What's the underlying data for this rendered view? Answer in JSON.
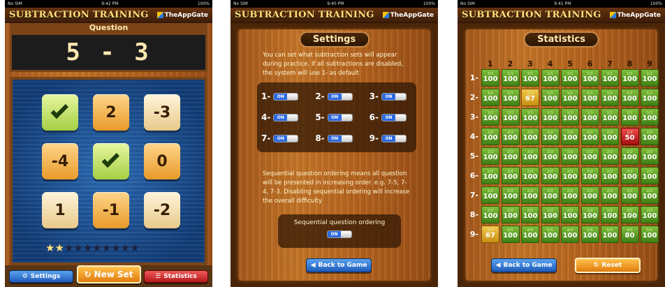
{
  "app": {
    "title": "SUBTRACTION TRAINING",
    "brand": "TheAppGate"
  },
  "screens": [
    {
      "status": {
        "left": "No SIM",
        "time": "9:42 PM",
        "battery": "100%"
      }
    },
    {
      "status": {
        "left": "No SIM",
        "time": "9:40 PM",
        "battery": "100%"
      }
    },
    {
      "status": {
        "left": "No SIM",
        "time": "9:41 PM",
        "battery": "100%"
      }
    }
  ],
  "game": {
    "question_label": "Question",
    "question": "5 - 3",
    "tiles": [
      "check",
      "2",
      "-3",
      "-4",
      "check",
      "0",
      "1",
      "-1",
      "-2"
    ],
    "stars_filled": 2,
    "stars_total": 10,
    "buttons": {
      "settings": "Settings",
      "new_set": "New Set",
      "statistics": "Statistics"
    }
  },
  "settings": {
    "title": "Settings",
    "intro": "You can set what subtraction sets will appear during practice. If all subtractions are disabled, the system will use 1- as default",
    "sets": [
      {
        "label": "1-",
        "state": "ON"
      },
      {
        "label": "2-",
        "state": "ON"
      },
      {
        "label": "3-",
        "state": "ON"
      },
      {
        "label": "4-",
        "state": "ON"
      },
      {
        "label": "5-",
        "state": "ON"
      },
      {
        "label": "6-",
        "state": "ON"
      },
      {
        "label": "7-",
        "state": "ON"
      },
      {
        "label": "8-",
        "state": "ON"
      },
      {
        "label": "9-",
        "state": "ON"
      }
    ],
    "seq_text": "Sequential question ordering means all question will be presented in increasing order. e.g. 7-5, 7-4, 7-3. Disabling sequential ordering will increase the overall difficulty",
    "seq_label": "Sequential question ordering",
    "seq_state": "ON",
    "back_button": "Back to Game"
  },
  "statistics": {
    "title": "Statistics",
    "columns": [
      "1",
      "2",
      "3",
      "4",
      "5",
      "6",
      "7",
      "8",
      "9"
    ],
    "rows": [
      "1-",
      "2-",
      "3-",
      "4-",
      "5-",
      "6-",
      "7-",
      "8-",
      "9-"
    ],
    "cells": [
      [
        "1/1",
        "1/1",
        "1/1",
        "1/1",
        "1/1",
        "1/1",
        "1/1",
        "1/1",
        "1/1"
      ],
      [
        "1/1",
        "1/1",
        "2/3",
        "1/1",
        "1/1",
        "1/1",
        "1/1",
        "1/1",
        "1/1"
      ],
      [
        "1/1",
        "1/1",
        "1/1",
        "1/1",
        "1/1",
        "1/1",
        "1/1",
        "1/1",
        "1/1"
      ],
      [
        "2/2",
        "2/2",
        "2/2",
        "2/2",
        "2/2",
        "2/2",
        "2/2",
        "1/2",
        "2/2"
      ],
      [
        "2/2",
        "2/2",
        "2/2",
        "2/2",
        "2/2",
        "2/2",
        "2/2",
        "2/2",
        "2/2"
      ],
      [
        "2/2",
        "2/2",
        "2/2",
        "2/2",
        "2/2",
        "2/2",
        "2/2",
        "2/2",
        "2/2"
      ],
      [
        "2/2",
        "2/2",
        "2/2",
        "2/2",
        "2/2",
        "2/2",
        "2/2",
        "2/2",
        "2/2"
      ],
      [
        "2/2",
        "2/2",
        "2/2",
        "2/2",
        "2/2",
        "2/2",
        "2/2",
        "2/2",
        "2/2"
      ],
      [
        "2/3",
        "5/5",
        "4/4",
        "5/5",
        "4/4",
        "5/5",
        "5/5",
        "4/5",
        "5/5"
      ]
    ],
    "percents": [
      [
        "100",
        "100",
        "100",
        "100",
        "100",
        "100",
        "100",
        "100",
        "100"
      ],
      [
        "100",
        "100",
        "67",
        "100",
        "100",
        "100",
        "100",
        "100",
        "100"
      ],
      [
        "100",
        "100",
        "100",
        "100",
        "100",
        "100",
        "100",
        "100",
        "100"
      ],
      [
        "100",
        "100",
        "100",
        "100",
        "100",
        "100",
        "100",
        "50",
        "100"
      ],
      [
        "100",
        "100",
        "100",
        "100",
        "100",
        "100",
        "100",
        "100",
        "100"
      ],
      [
        "100",
        "100",
        "100",
        "100",
        "100",
        "100",
        "100",
        "100",
        "100"
      ],
      [
        "100",
        "100",
        "100",
        "100",
        "100",
        "100",
        "100",
        "100",
        "100"
      ],
      [
        "100",
        "100",
        "100",
        "100",
        "100",
        "100",
        "100",
        "100",
        "100"
      ],
      [
        "67",
        "100",
        "100",
        "100",
        "100",
        "100",
        "100",
        "80",
        "100"
      ]
    ],
    "back_button": "Back to Game",
    "reset_button": "Reset"
  }
}
